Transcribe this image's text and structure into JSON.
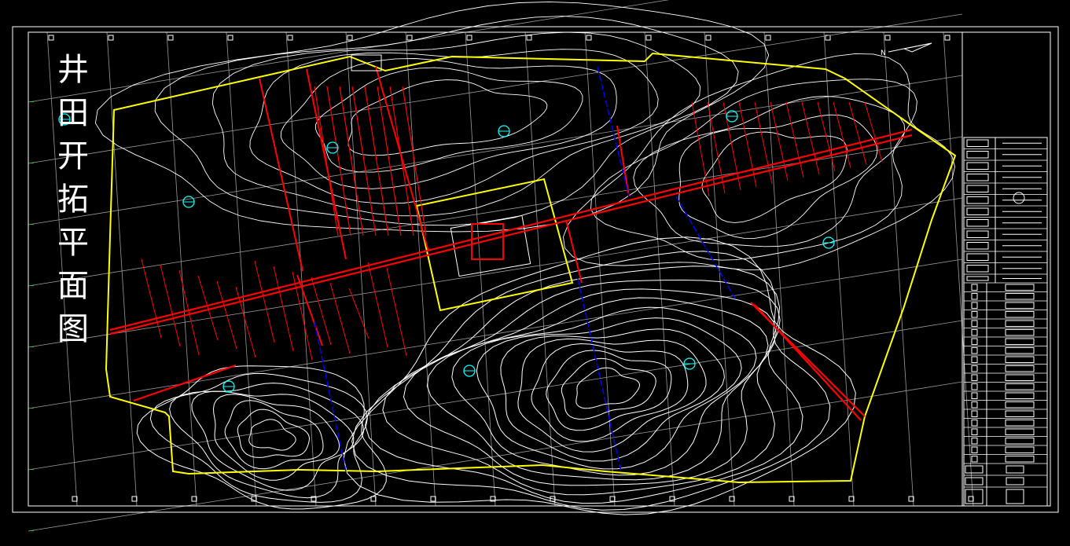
{
  "drawing": {
    "title_chars": [
      "井",
      "田",
      "开",
      "拓",
      "平",
      "面",
      "图"
    ],
    "colors": {
      "background": "#000000",
      "frame": "#ffffff",
      "grid": "#9a9a9a",
      "boundary": "#ffff00",
      "contour": "#ffffff",
      "roadway": "#ff0000",
      "fault": "#0000ff",
      "shaft": "#00ffff",
      "grid_label": "#00ff00"
    },
    "north_arrow_label": "N"
  }
}
